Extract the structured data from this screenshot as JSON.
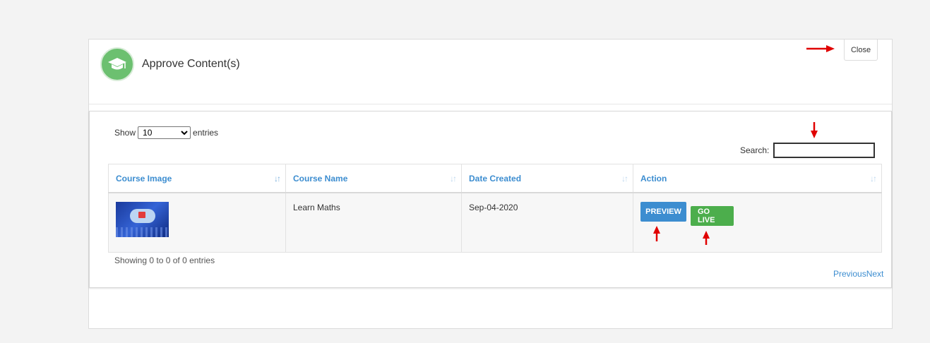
{
  "modal": {
    "title": "Approve Content(s)",
    "close_label": "Close",
    "logo_icon": "graduation-cap-icon"
  },
  "table_controls": {
    "show_label": "Show",
    "entries_label": "entries",
    "page_size": "10",
    "search_label": "Search:",
    "search_value": ""
  },
  "table": {
    "columns": [
      "Course Image",
      "Course Name",
      "Date Created",
      "Action"
    ],
    "rows": [
      {
        "course_name": "Learn Maths",
        "date_created": "Sep-04-2020",
        "preview_label": "PREVIEW",
        "go_live_label": "GO LIVE"
      }
    ]
  },
  "footer": {
    "info": "Showing 0 to 0 of 0 entries",
    "previous": "Previous",
    "next": "Next"
  },
  "colors": {
    "link_blue": "#3c8dd0",
    "go_live_green": "#4cae4c",
    "annotation_red": "#e00000",
    "logo_green": "#6cc070"
  }
}
